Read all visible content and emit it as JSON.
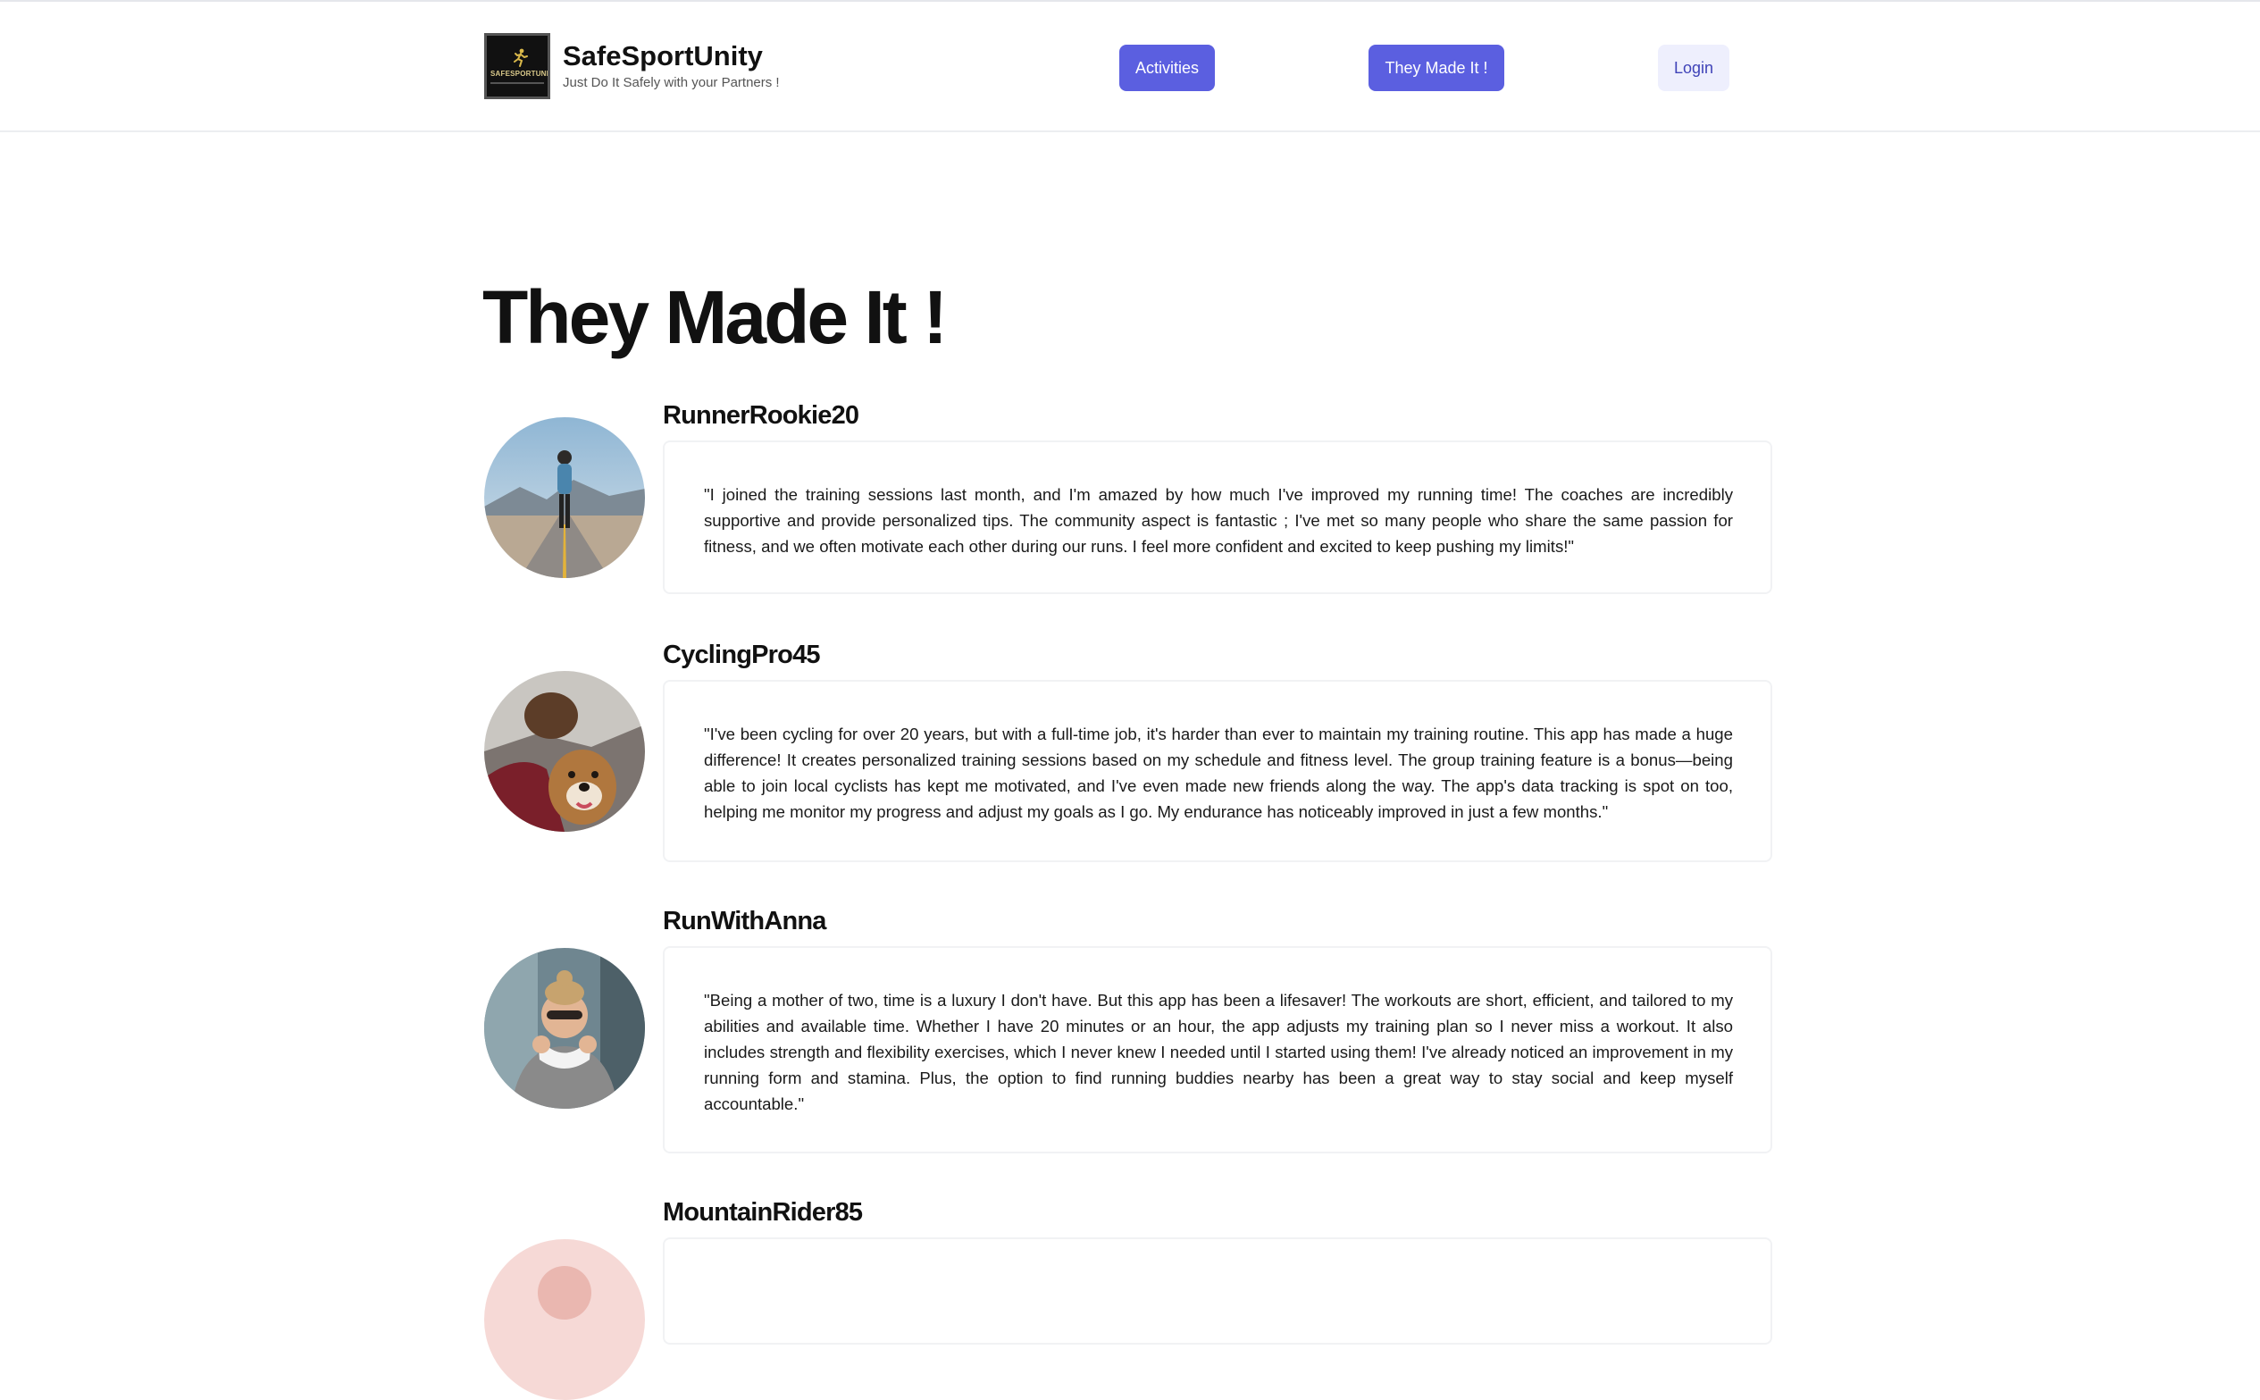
{
  "brand": {
    "logo_text": "SAFESPORTUNITY",
    "name": "SafeSportUnity",
    "tagline": "Just Do It Safely with your Partners !"
  },
  "nav": {
    "activities": "Activities",
    "they_made_it": "They Made It !",
    "login": "Login"
  },
  "page": {
    "title": "They Made It !"
  },
  "testimonials": [
    {
      "username": "RunnerRookie20",
      "quote": "\"I joined the training sessions last month, and I'm amazed by how much I've improved my running time! The coaches are incredibly supportive and provide personalized tips. The community aspect is fantastic ; I've met so many people who share the same passion for fitness, and we often motivate each other during our runs. I feel more confident and excited to keep pushing my limits!\""
    },
    {
      "username": "CyclingPro45",
      "quote": "\"I've been cycling for over 20 years, but with a full-time job, it's harder than ever to maintain my training routine. This app has made a huge difference! It creates personalized training sessions based on my schedule and fitness level. The group training feature is a bonus—being able to join local cyclists has kept me motivated, and I've even made new friends along the way. The app's data tracking is spot on too, helping me monitor my progress and adjust my goals as I go. My endurance has noticeably improved in just a few months.\""
    },
    {
      "username": "RunWithAnna",
      "quote": "\"Being a mother of two, time is a luxury I don't have. But this app has been a lifesaver! The workouts are short, efficient, and tailored to my abilities and available time. Whether I have 20 minutes or an hour, the app adjusts my training plan so I never miss a workout. It also includes strength and flexibility exercises, which I never knew I needed until I started using them! I've already noticed an improvement in my running form and stamina. Plus, the option to find running buddies nearby has been a great way to stay social and keep myself accountable.\""
    },
    {
      "username": "MountainRider85",
      "quote": ""
    }
  ],
  "colors": {
    "primary": "#5b5fe0",
    "primary_light": "#eeeffd"
  }
}
